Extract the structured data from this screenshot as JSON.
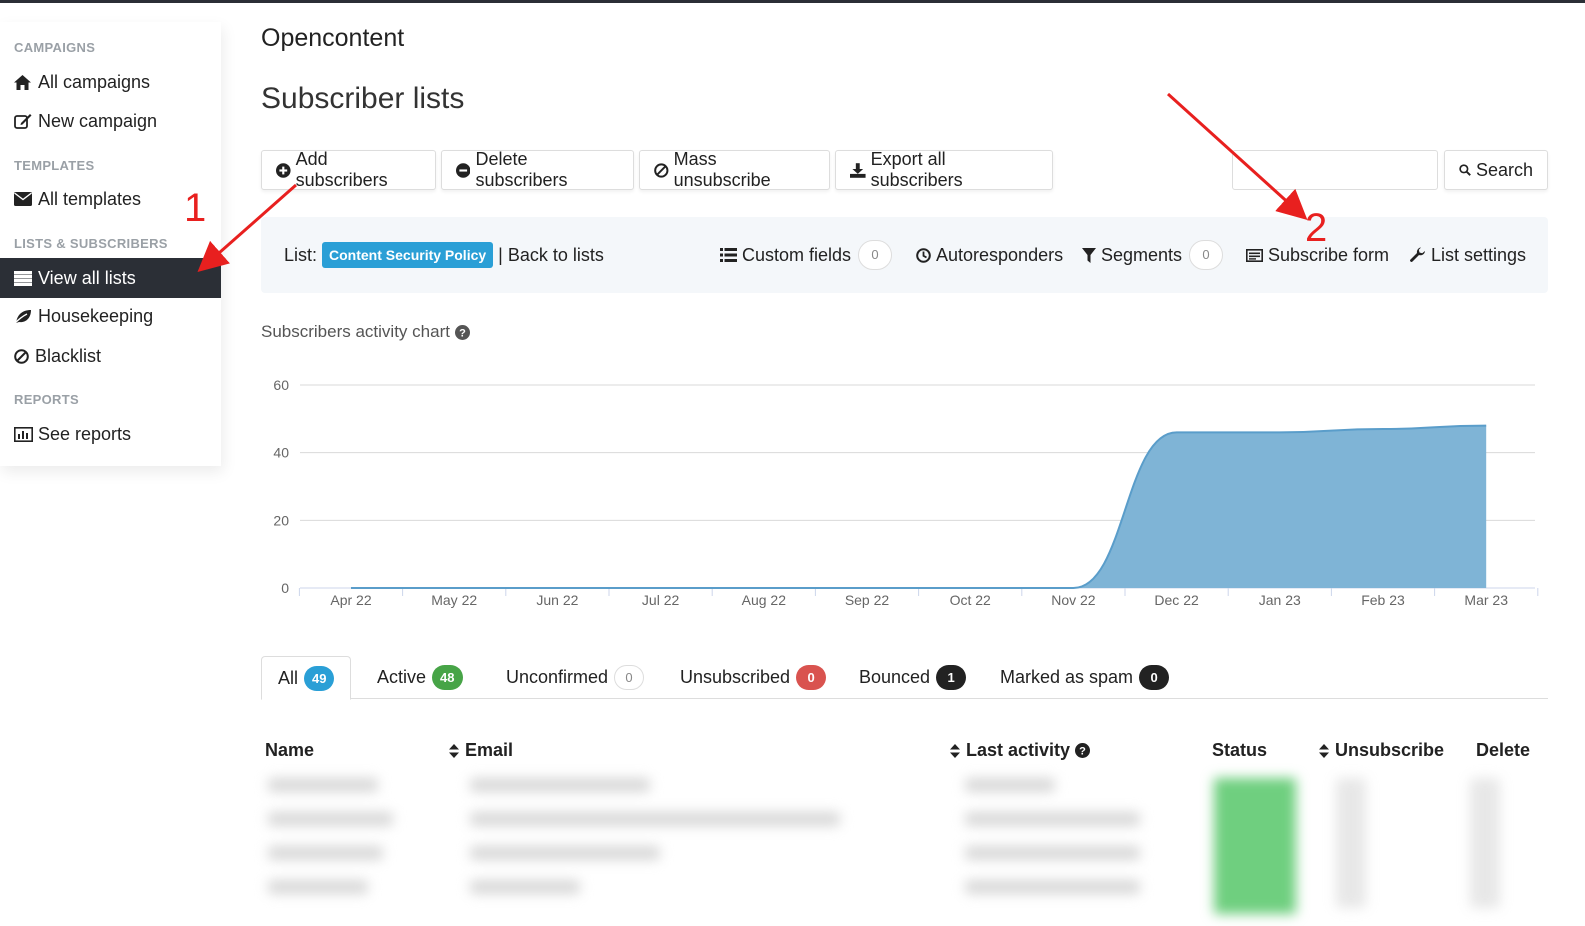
{
  "sidebar": {
    "sections": [
      {
        "heading": "CAMPAIGNS",
        "items": [
          {
            "label": "All campaigns",
            "icon": "home-icon"
          },
          {
            "label": "New campaign",
            "icon": "edit-icon"
          }
        ]
      },
      {
        "heading": "TEMPLATES",
        "items": [
          {
            "label": "All templates",
            "icon": "envelope-icon"
          }
        ]
      },
      {
        "heading": "LISTS & SUBSCRIBERS",
        "items": [
          {
            "label": "View all lists",
            "icon": "list-icon",
            "active": true
          },
          {
            "label": "Housekeeping",
            "icon": "leaf-icon"
          },
          {
            "label": "Blacklist",
            "icon": "ban-icon"
          }
        ]
      },
      {
        "heading": "REPORTS",
        "items": [
          {
            "label": "See reports",
            "icon": "bar-chart-icon"
          }
        ]
      }
    ]
  },
  "header": {
    "brand": "Opencontent",
    "title": "Subscriber lists"
  },
  "toolbar": {
    "add": "Add subscribers",
    "delete": "Delete subscribers",
    "mass_unsub": "Mass unsubscribe",
    "export": "Export all subscribers",
    "search_button": "Search",
    "search_value": ""
  },
  "list_bar": {
    "list_prefix": "List:",
    "list_name": "Content Security Policy",
    "back": "| Back to lists",
    "custom_fields": "Custom fields",
    "custom_fields_count": "0",
    "autoresponders": "Autoresponders",
    "segments": "Segments",
    "segments_count": "0",
    "subscribe_form": "Subscribe form",
    "list_settings": "List settings"
  },
  "chart_title": "Subscribers activity chart",
  "chart_data": {
    "type": "area",
    "x": [
      "Apr 22",
      "May 22",
      "Jun 22",
      "Jul 22",
      "Aug 22",
      "Sep 22",
      "Oct 22",
      "Nov 22",
      "Dec 22",
      "Jan 23",
      "Feb 23",
      "Mar 23"
    ],
    "values": [
      0,
      0,
      0,
      0,
      0,
      0,
      0,
      0,
      46,
      46,
      47,
      48
    ],
    "ylim": [
      0,
      60
    ],
    "yticks": [
      0,
      20,
      40,
      60
    ],
    "grid": true,
    "color": "#7fb4d6"
  },
  "tabs": [
    {
      "label": "All",
      "count": "49",
      "color": "#2a9fd6",
      "active": true
    },
    {
      "label": "Active",
      "count": "48",
      "color": "#47a447"
    },
    {
      "label": "Unconfirmed",
      "count": "0",
      "color": "outline"
    },
    {
      "label": "Unsubscribed",
      "count": "0",
      "color": "#d9534f"
    },
    {
      "label": "Bounced",
      "count": "1",
      "color": "#222222"
    },
    {
      "label": "Marked as spam",
      "count": "0",
      "color": "#222222"
    }
  ],
  "table": {
    "headers": {
      "name": "Name",
      "email": "Email",
      "last_activity": "Last activity",
      "status": "Status",
      "unsubscribe": "Unsubscribe",
      "delete": "Delete"
    }
  },
  "annotations": {
    "one": "1",
    "two": "2",
    "color": "#e8201f"
  }
}
